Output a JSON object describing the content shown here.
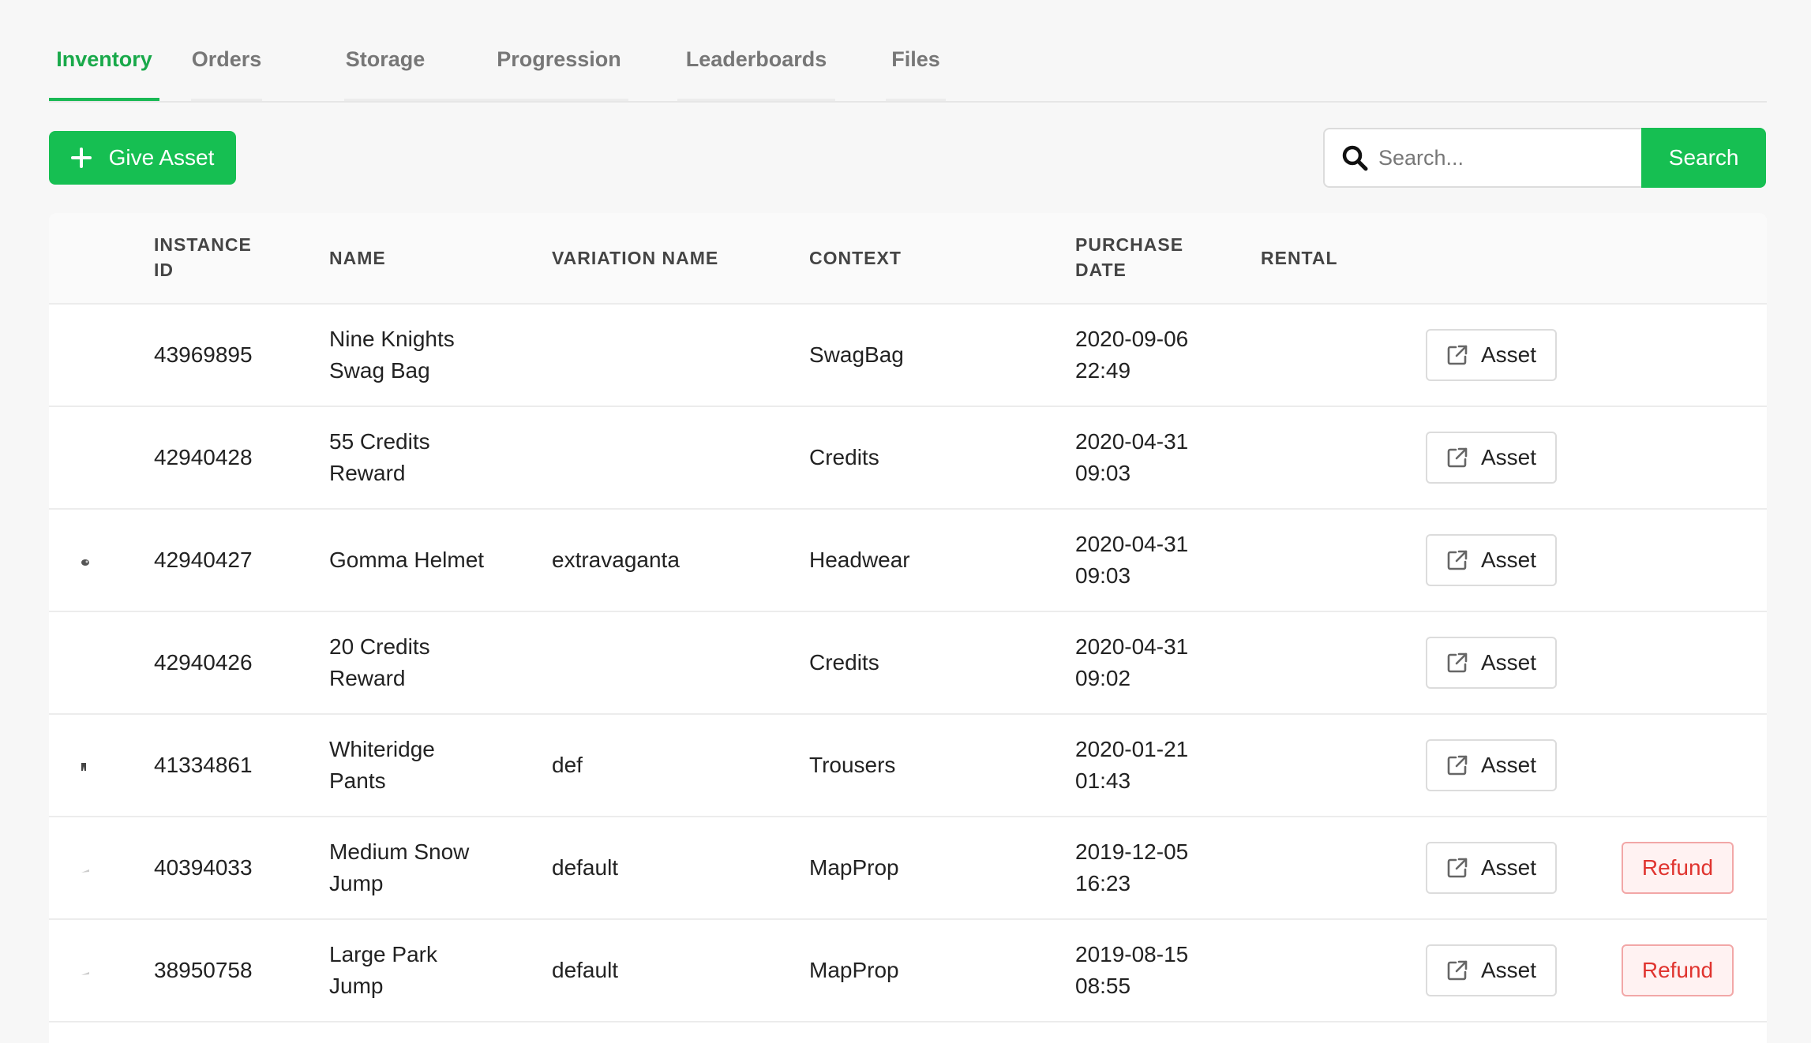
{
  "tabs": [
    {
      "label": "Inventory",
      "active": true
    },
    {
      "label": "Orders",
      "active": false
    },
    {
      "label": "Storage",
      "active": false
    },
    {
      "label": "Progression",
      "active": false
    },
    {
      "label": "Leaderboards",
      "active": false
    },
    {
      "label": "Files",
      "active": false
    }
  ],
  "toolbar": {
    "give_asset_label": "Give Asset",
    "search_placeholder": "Search...",
    "search_button_label": "Search"
  },
  "table": {
    "headers": {
      "instance_id": "INSTANCE ID",
      "name": "NAME",
      "variation_name": "VARIATION NAME",
      "context": "CONTEXT",
      "purchase_date": "PURCHASE DATE",
      "rental": "RENTAL"
    },
    "rows": [
      {
        "instance_id": "43969895",
        "name": "Nine Knights Swag Bag",
        "variation": "",
        "context": "SwagBag",
        "purchase_date": "2020-09-06 22:49",
        "asset_label": "Asset",
        "refund_label": "",
        "thumb": ""
      },
      {
        "instance_id": "42940428",
        "name": "55 Credits Reward",
        "variation": "",
        "context": "Credits",
        "purchase_date": "2020-04-31 09:03",
        "asset_label": "Asset",
        "refund_label": "",
        "thumb": ""
      },
      {
        "instance_id": "42940427",
        "name": "Gomma Helmet",
        "variation": "extravaganta",
        "context": "Headwear",
        "purchase_date": "2020-04-31 09:03",
        "asset_label": "Asset",
        "refund_label": "",
        "thumb": "helmet-thumbnail"
      },
      {
        "instance_id": "42940426",
        "name": "20 Credits Reward",
        "variation": "",
        "context": "Credits",
        "purchase_date": "2020-04-31 09:02",
        "asset_label": "Asset",
        "refund_label": "",
        "thumb": ""
      },
      {
        "instance_id": "41334861",
        "name": "Whiteridge Pants",
        "variation": "def",
        "context": "Trousers",
        "purchase_date": "2020-01-21 01:43",
        "asset_label": "Asset",
        "refund_label": "",
        "thumb": "trousers-thumbnail"
      },
      {
        "instance_id": "40394033",
        "name": "Medium Snow Jump",
        "variation": "default",
        "context": "MapProp",
        "purchase_date": "2019-12-05 16:23",
        "asset_label": "Asset",
        "refund_label": "Refund",
        "thumb": "mapprop-thumbnail"
      },
      {
        "instance_id": "38950758",
        "name": "Large Park Jump",
        "variation": "default",
        "context": "MapProp",
        "purchase_date": "2019-08-15 08:55",
        "asset_label": "Asset",
        "refund_label": "Refund",
        "thumb": "mapprop-thumbnail"
      }
    ]
  },
  "colors": {
    "accent": "#16bf52",
    "active_tab_text": "#19a94a",
    "refund_text": "#e0342f",
    "refund_bg": "#fff2f2"
  },
  "icons": {
    "give_asset": "plus-icon",
    "search": "search-icon",
    "asset_link": "external-link-icon"
  }
}
